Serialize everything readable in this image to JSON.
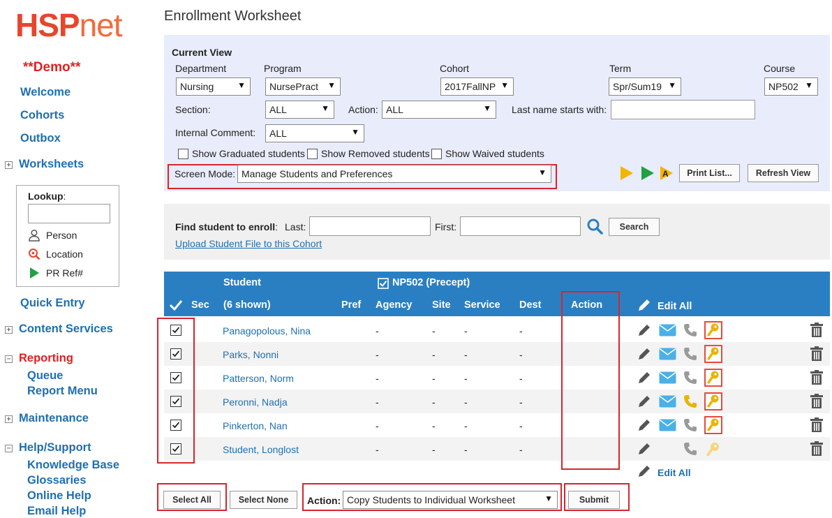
{
  "sidebar": {
    "logo_hsp": "HSP",
    "logo_net": "net",
    "demo": "**Demo**",
    "welcome": "Welcome",
    "cohorts": "Cohorts",
    "outbox": "Outbox",
    "worksheets": "Worksheets",
    "lookup": {
      "label": "Lookup",
      "person": "Person",
      "location": "Location",
      "prref": "PR Ref#"
    },
    "quick_entry": "Quick Entry",
    "content_services": "Content Services",
    "reporting": "Reporting",
    "queue": "Queue",
    "report_menu": "Report Menu",
    "maintenance": "Maintenance",
    "help_support": "Help/Support",
    "knowledge_base": "Knowledge Base",
    "glossaries": "Glossaries",
    "online_help": "Online Help",
    "email_help": "Email Help"
  },
  "page_title": "Enrollment Worksheet",
  "current_view": {
    "heading": "Current View",
    "department_label": "Department",
    "department_value": "Nursing",
    "program_label": "Program",
    "program_value": "NursePract",
    "cohort_label": "Cohort",
    "cohort_value": "2017FallNP",
    "term_label": "Term",
    "term_value": "Spr/Sum19",
    "course_label": "Course",
    "course_value": "NP502",
    "section_label": "Section:",
    "section_value": "ALL",
    "action_label": "Action:",
    "action_value": "ALL",
    "lastname_label": "Last name starts with:",
    "comment_label": "Internal Comment:",
    "comment_value": "ALL",
    "show_graduated": "Show Graduated students",
    "show_removed": "Show Removed students",
    "show_waived": "Show Waived students",
    "screen_mode_label": "Screen Mode:",
    "screen_mode_value": "Manage Students and Preferences",
    "print_list": "Print List...",
    "refresh_view": "Refresh View"
  },
  "find": {
    "label": "Find student to enroll",
    "last_label": "Last:",
    "first_label": "First:",
    "search": "Search",
    "upload_link": "Upload Student File to this Cohort"
  },
  "table": {
    "student_header": "Student",
    "course_header": "NP502  (Precept)",
    "sec": "Sec",
    "shown": "(6 shown)",
    "pref": "Pref",
    "agency": "Agency",
    "site": "Site",
    "service": "Service",
    "dest": "Dest",
    "action": "Action",
    "edit_all": "Edit All",
    "rows": [
      {
        "name": "Panagopolous, Nina",
        "agency": "-",
        "site": "-",
        "service": "-",
        "dest": "-"
      },
      {
        "name": "Parks, Nonni",
        "agency": "-",
        "site": "-",
        "service": "-",
        "dest": "-"
      },
      {
        "name": "Patterson, Norm",
        "agency": "-",
        "site": "-",
        "service": "-",
        "dest": "-"
      },
      {
        "name": "Peronni, Nadja",
        "agency": "-",
        "site": "-",
        "service": "-",
        "dest": "-"
      },
      {
        "name": "Pinkerton, Nan",
        "agency": "-",
        "site": "-",
        "service": "-",
        "dest": "-"
      },
      {
        "name": "Student, Longlost",
        "agency": "-",
        "site": "-",
        "service": "-",
        "dest": "-"
      }
    ],
    "edit_all_bottom": "Edit All"
  },
  "bottom": {
    "select_all": "Select All",
    "select_none": "Select None",
    "action_label": "Action:",
    "action_value": "Copy Students to Individual Worksheet",
    "submit": "Submit"
  },
  "colors": {
    "link": "#1f6fb0",
    "header_bg": "#2a7fc3",
    "highlight": "#d6252e",
    "panel_bg": "#e9ecfa"
  }
}
